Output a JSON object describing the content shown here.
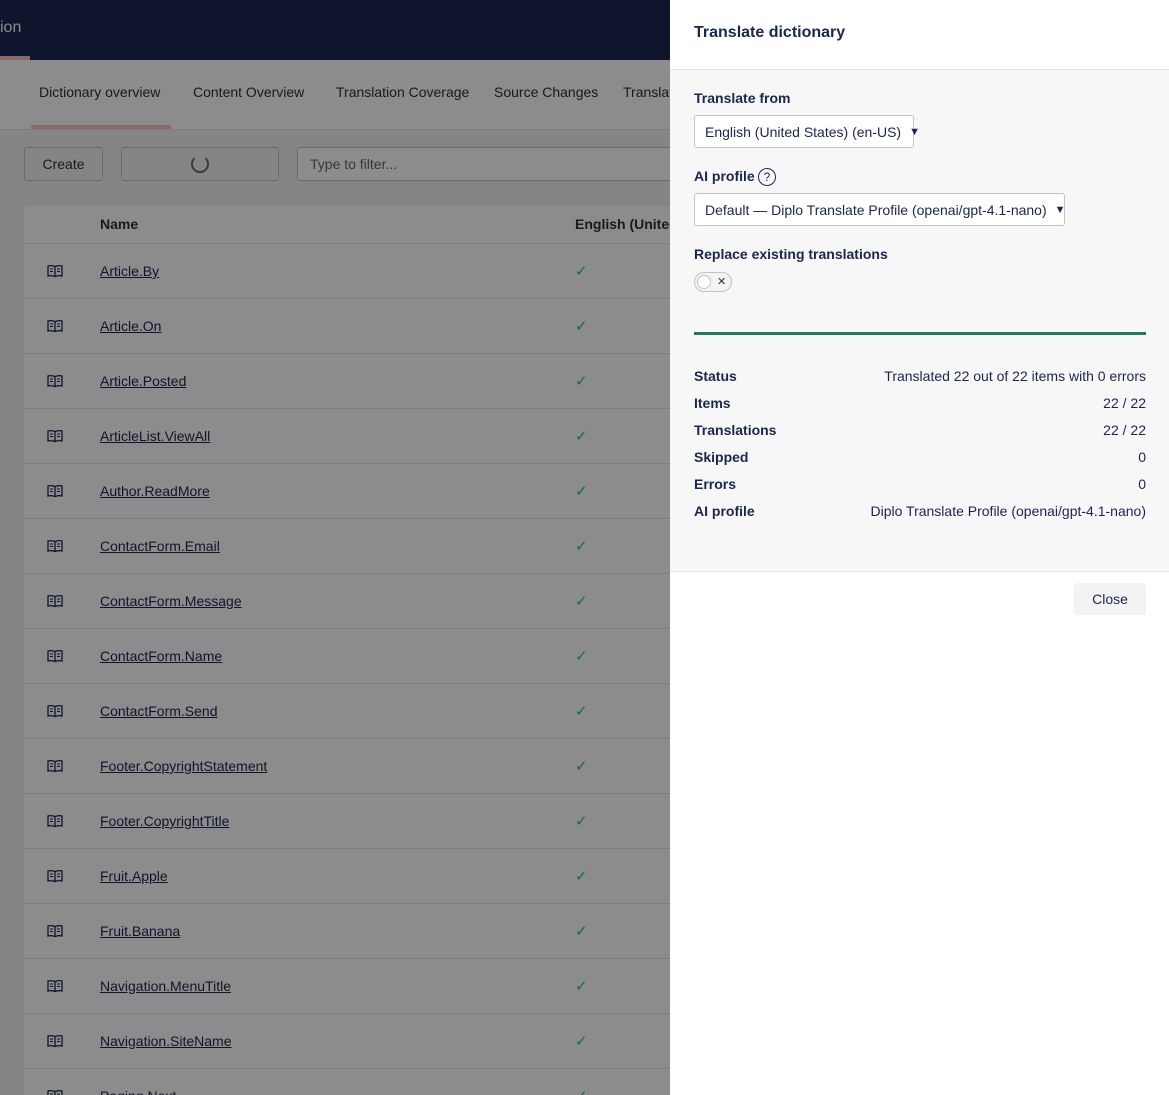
{
  "app": {
    "section_title": "ion",
    "tabs": [
      "Dictionary overview",
      "Content Overview",
      "Translation Coverage",
      "Source Changes",
      "Translat"
    ],
    "create_label": "Create",
    "filter_placeholder": "Type to filter...",
    "table": {
      "col_name": "Name",
      "col_lang": "English (United",
      "rows": [
        "Article.By",
        "Article.On",
        "Article.Posted",
        "ArticleList.ViewAll",
        "Author.ReadMore",
        "ContactForm.Email",
        "ContactForm.Message",
        "ContactForm.Name",
        "ContactForm.Send",
        "Footer.CopyrightStatement",
        "Footer.CopyrightTitle",
        "Fruit.Apple",
        "Fruit.Banana",
        "Navigation.MenuTitle",
        "Navigation.SiteName",
        "Paging.Next"
      ],
      "check_glyph": "✓"
    }
  },
  "panel": {
    "title": "Translate dictionary",
    "translate_from_label": "Translate from",
    "translate_from_value": "English (United States) (en-US)",
    "ai_profile_label": "AI profile",
    "ai_profile_value": "Default — Diplo Translate Profile (openai/gpt-4.1-nano)",
    "replace_label": "Replace existing translations",
    "replace_enabled": false,
    "progress_percent": 100,
    "stats": [
      {
        "key": "Status",
        "value": "Translated 22 out of 22 items with 0 errors"
      },
      {
        "key": "Items",
        "value": "22 / 22"
      },
      {
        "key": "Translations",
        "value": "22 / 22"
      },
      {
        "key": "Skipped",
        "value": "0"
      },
      {
        "key": "Errors",
        "value": "0"
      },
      {
        "key": "AI profile",
        "value": "Diplo Translate Profile (openai/gpt-4.1-nano)"
      }
    ],
    "close_label": "Close"
  },
  "colors": {
    "header": "#1b264f",
    "accent": "#f5c1bc",
    "success": "#2bc37c",
    "progress": "#1b7f5b"
  },
  "icons": {
    "row_icon": "book-icon",
    "help": "help-circle-icon",
    "toggle_off": "x-icon"
  }
}
